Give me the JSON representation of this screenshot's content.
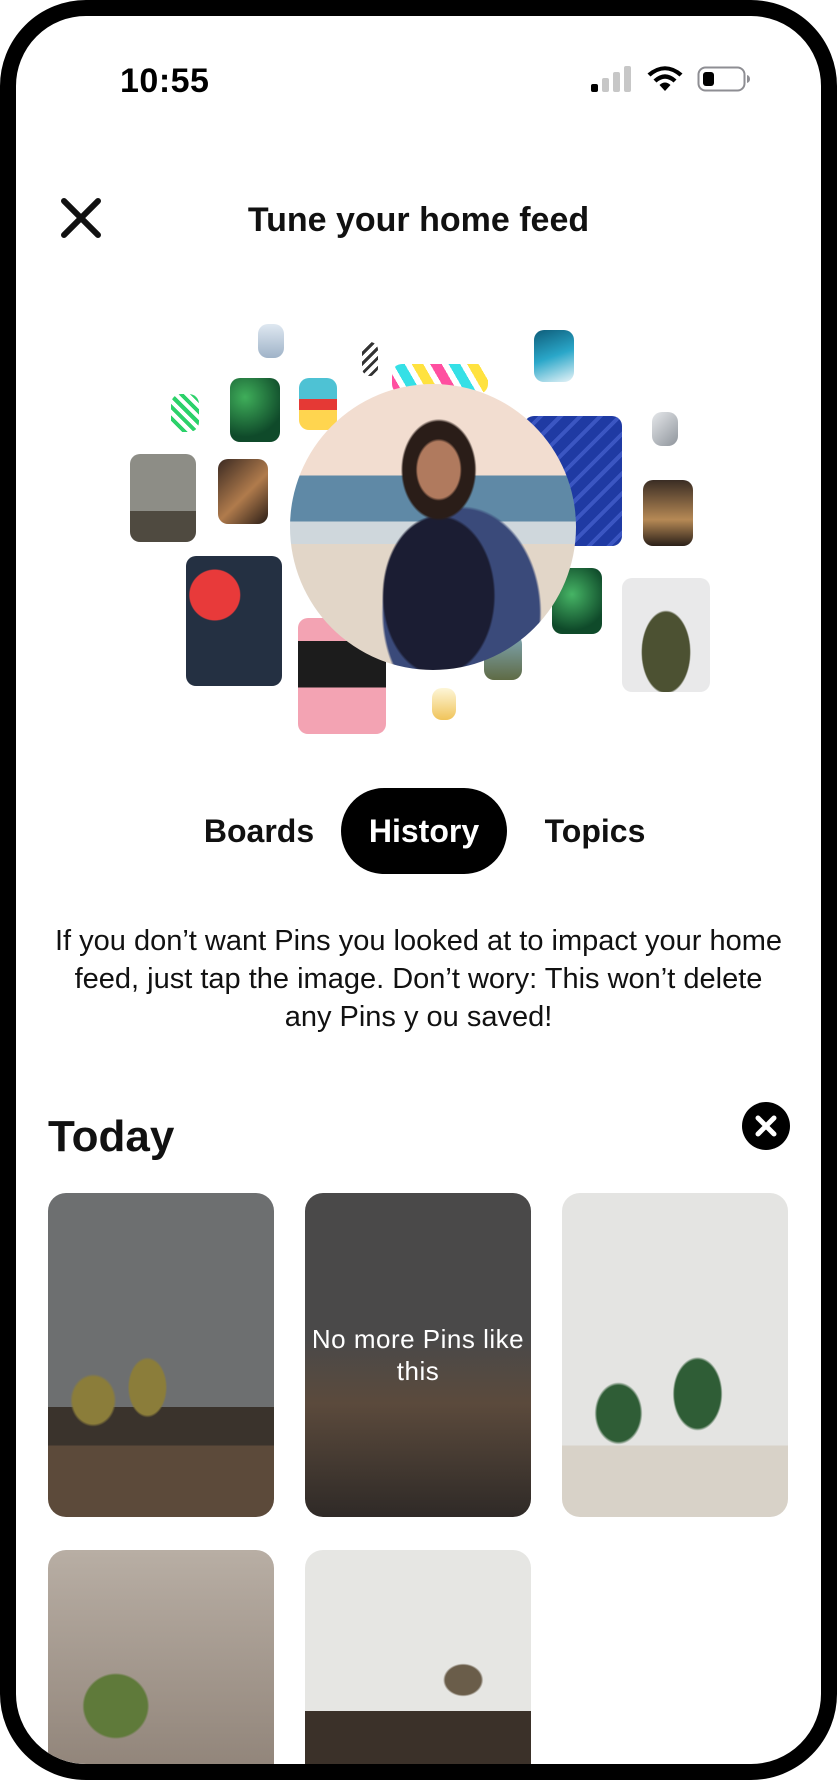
{
  "status_bar": {
    "time": "10:55"
  },
  "header": {
    "title": "Tune your home feed"
  },
  "tabs": [
    {
      "label": "Boards",
      "active": false
    },
    {
      "label": "History",
      "active": true
    },
    {
      "label": "Topics",
      "active": false
    }
  ],
  "description": "If you don’t want Pins you looked at to impact your home feed, just tap the image. Don’t wory: This won’t delete any Pins y ou saved!",
  "section": {
    "title": "Today"
  },
  "pins": [
    {
      "overlay": ""
    },
    {
      "overlay": "No more Pins like this"
    },
    {
      "overlay": ""
    },
    {
      "overlay": ""
    },
    {
      "overlay": ""
    }
  ],
  "colors": {
    "active_tab_bg": "#000000",
    "text": "#111111"
  }
}
